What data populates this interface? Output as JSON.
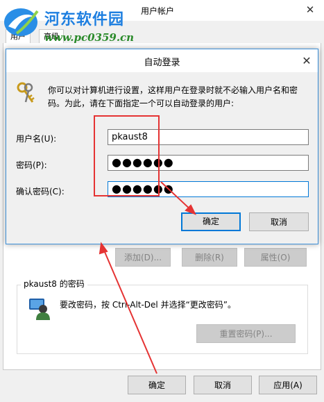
{
  "background_window": {
    "title": "用户帐户",
    "close_glyph": "✕",
    "tabs": [
      "用户",
      "高级"
    ],
    "buttons": {
      "add": "添加(D)...",
      "remove": "删除(R)",
      "properties": "属性(O)"
    },
    "password_group": {
      "title": "pkaust8 的密码",
      "text": "要改密码，按 Ctrl-Alt-Del 并选择“更改密码”。",
      "reset_button": "重置密码(P)..."
    },
    "footer": {
      "ok": "确定",
      "cancel": "取消",
      "apply": "应用(A)"
    }
  },
  "dialog": {
    "title": "自动登录",
    "close_glyph": "✕",
    "description": "你可以对计算机进行设置，这样用户在登录时就不必输入用户名和密码。为此，请在下面指定一个可以自动登录的用户:",
    "fields": [
      {
        "label": "用户名(U):",
        "value": "pkaust8",
        "type": "text"
      },
      {
        "label": "密码(P):",
        "value": "●●●●●●",
        "type": "password"
      },
      {
        "label": "确认密码(C):",
        "value": "●●●●●●",
        "type": "password"
      }
    ],
    "ok": "确定",
    "cancel": "取消"
  },
  "watermark": {
    "name": "河东软件园",
    "url": "www.pc0359.cn"
  },
  "icons": {
    "dialog": "keys-icon",
    "user": "user-account-icon",
    "logo": "site-logo-icon"
  },
  "colors": {
    "annotation": "#e53333",
    "focus": "#0078d7"
  }
}
